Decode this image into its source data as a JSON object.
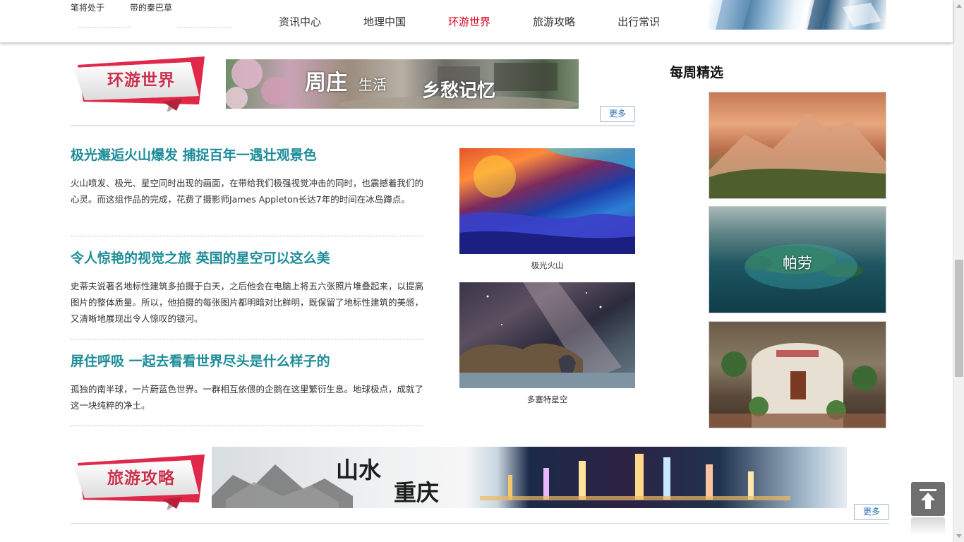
{
  "header": {
    "ticker_text": "笔将处于",
    "ticker_text_2": "带的秦巴草",
    "nav": [
      {
        "label": "资讯中心",
        "active": false
      },
      {
        "label": "地理中国",
        "active": false
      },
      {
        "label": "环游世界",
        "active": true
      },
      {
        "label": "旅游攻略",
        "active": false
      },
      {
        "label": "出行常识",
        "active": false
      }
    ]
  },
  "section_world": {
    "badge": "环游世界",
    "banner_text_1": "周庄",
    "banner_text_2": "生活",
    "banner_text_3": "乡愁记忆",
    "more": "更多"
  },
  "articles": [
    {
      "title": "极光邂逅火山爆发 捕捉百年一遇壮观景色",
      "desc": "火山喷发、极光、星空同时出现的画面，在带给我们极强视觉冲击的同时，也震撼着我们的心灵。而这组作品的完成，花费了摄影师James Appleton长达7年的时间在冰岛蹲点。"
    },
    {
      "title": "令人惊艳的视觉之旅 英国的星空可以这么美",
      "desc": "史蒂夫说著名地标性建筑多拍摄于白天，之后他会在电脑上将五六张照片堆叠起来，以提高图片的整体质量。所以，他拍摄的每张图片都明暗对比鲜明，既保留了地标性建筑的美感，又清晰地展现出令人惊叹的银河。"
    },
    {
      "title": "屏住呼吸 一起去看看世界尽头是什么样子的",
      "desc": "孤独的南半球，一片蔚蓝色世界。一群相互依偎的企鹅在这里繁衍生息。地球极点，成就了这一块纯粹的净土。"
    }
  ],
  "photos": [
    {
      "caption": "极光火山"
    },
    {
      "caption": "多塞特星空"
    }
  ],
  "sidebar": {
    "title": "每周精选",
    "cards": [
      {
        "label": ""
      },
      {
        "label": "帕劳"
      },
      {
        "label": ""
      }
    ]
  },
  "section_guide": {
    "badge": "旅游攻略",
    "banner_text_1": "山水",
    "banner_text_2": "重庆",
    "more": "更多"
  },
  "colors": {
    "accent_red": "#d9001b",
    "title_teal": "#1e8d99",
    "badge_pink": "#e0294a"
  }
}
